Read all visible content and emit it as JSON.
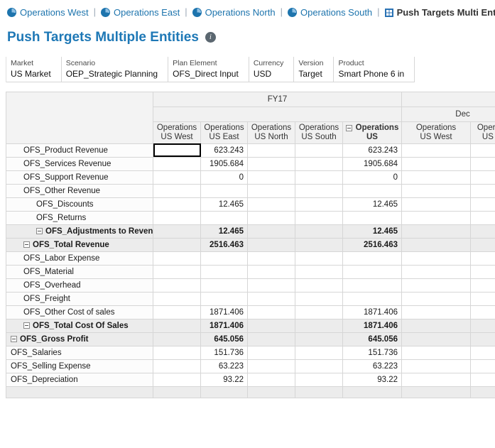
{
  "nav": {
    "separator": "|",
    "items": [
      {
        "label": "Operations West",
        "icon": "pie-chart-icon"
      },
      {
        "label": "Operations East",
        "icon": "pie-chart-icon"
      },
      {
        "label": "Operations North",
        "icon": "pie-chart-icon"
      },
      {
        "label": "Operations South",
        "icon": "pie-chart-icon"
      },
      {
        "label": "Push Targets Multi Entity",
        "icon": "form-icon",
        "active": true
      }
    ]
  },
  "page": {
    "title": "Push Targets Multiple Entities"
  },
  "pov": [
    {
      "label": "Market",
      "value": "US Market"
    },
    {
      "label": "Scenario",
      "value": "OEP_Strategic Planning"
    },
    {
      "label": "Plan Element",
      "value": "OFS_Direct Input"
    },
    {
      "label": "Currency",
      "value": "USD"
    },
    {
      "label": "Version",
      "value": "Target"
    },
    {
      "label": "Product",
      "value": "Smart Phone 6 in"
    }
  ],
  "grid": {
    "year_header": "FY17",
    "month_header": "Dec",
    "columns": [
      {
        "line1": "Operations",
        "line2": "US West"
      },
      {
        "line1": "Operations",
        "line2": "US East"
      },
      {
        "line1": "Operations",
        "line2": "US North"
      },
      {
        "line1": "Operations",
        "line2": "US South"
      },
      {
        "line1": "Operations",
        "line2": "US",
        "bold": true,
        "collapse": true
      },
      {
        "line1": "Operations",
        "line2": "US West"
      },
      {
        "line1": "Operations",
        "line2": "US East"
      }
    ],
    "rows": [
      {
        "label": "OFS_Product Revenue",
        "level": 1,
        "selected_col": 0,
        "values": [
          "",
          "623.243",
          "",
          "",
          "623.243",
          "",
          ""
        ]
      },
      {
        "label": "OFS_Services Revenue",
        "level": 1,
        "values": [
          "",
          "1905.684",
          "",
          "",
          "1905.684",
          "",
          ""
        ]
      },
      {
        "label": "OFS_Support Revenue",
        "level": 1,
        "values": [
          "",
          "0",
          "",
          "",
          "0",
          "",
          ""
        ]
      },
      {
        "label": "OFS_Other Revenue",
        "level": 1,
        "values": [
          "",
          "",
          "",
          "",
          "",
          "",
          ""
        ]
      },
      {
        "label": "OFS_Discounts",
        "level": 2,
        "values": [
          "",
          "12.465",
          "",
          "",
          "12.465",
          "",
          ""
        ]
      },
      {
        "label": "OFS_Returns",
        "level": 2,
        "values": [
          "",
          "",
          "",
          "",
          "",
          "",
          ""
        ]
      },
      {
        "label": "OFS_Adjustments to Revenue",
        "level": 2,
        "total": true,
        "collapse": true,
        "values": [
          "",
          "12.465",
          "",
          "",
          "12.465",
          "",
          ""
        ]
      },
      {
        "label": "OFS_Total Revenue",
        "level": 1,
        "total": true,
        "collapse": true,
        "values": [
          "",
          "2516.463",
          "",
          "",
          "2516.463",
          "",
          ""
        ]
      },
      {
        "label": "OFS_Labor Expense",
        "level": 1,
        "values": [
          "",
          "",
          "",
          "",
          "",
          "",
          ""
        ]
      },
      {
        "label": "OFS_Material",
        "level": 1,
        "values": [
          "",
          "",
          "",
          "",
          "",
          "",
          ""
        ]
      },
      {
        "label": "OFS_Overhead",
        "level": 1,
        "values": [
          "",
          "",
          "",
          "",
          "",
          "",
          ""
        ]
      },
      {
        "label": "OFS_Freight",
        "level": 1,
        "values": [
          "",
          "",
          "",
          "",
          "",
          "",
          ""
        ]
      },
      {
        "label": "OFS_Other Cost of sales",
        "level": 1,
        "values": [
          "",
          "1871.406",
          "",
          "",
          "1871.406",
          "",
          ""
        ]
      },
      {
        "label": "OFS_Total Cost Of Sales",
        "level": 1,
        "total": true,
        "collapse": true,
        "values": [
          "",
          "1871.406",
          "",
          "",
          "1871.406",
          "",
          ""
        ]
      },
      {
        "label": "OFS_Gross Profit",
        "level": 0,
        "total": true,
        "collapse": true,
        "values": [
          "",
          "645.056",
          "",
          "",
          "645.056",
          "",
          ""
        ]
      },
      {
        "label": "OFS_Salaries",
        "level": 0,
        "values": [
          "",
          "151.736",
          "",
          "",
          "151.736",
          "",
          ""
        ]
      },
      {
        "label": "OFS_Selling Expense",
        "level": 0,
        "values": [
          "",
          "63.223",
          "",
          "",
          "63.223",
          "",
          ""
        ]
      },
      {
        "label": "OFS_Depreciation",
        "level": 0,
        "values": [
          "",
          "93.22",
          "",
          "",
          "93.22",
          "",
          ""
        ]
      }
    ]
  },
  "colors": {
    "accent_blue": "#1d74ad",
    "title_blue": "#1e78b6",
    "header_bg": "#f1f1f1",
    "total_row_bg": "#ececec",
    "grid_border": "#d6d6d6",
    "selected_cell_border": "#000000"
  }
}
